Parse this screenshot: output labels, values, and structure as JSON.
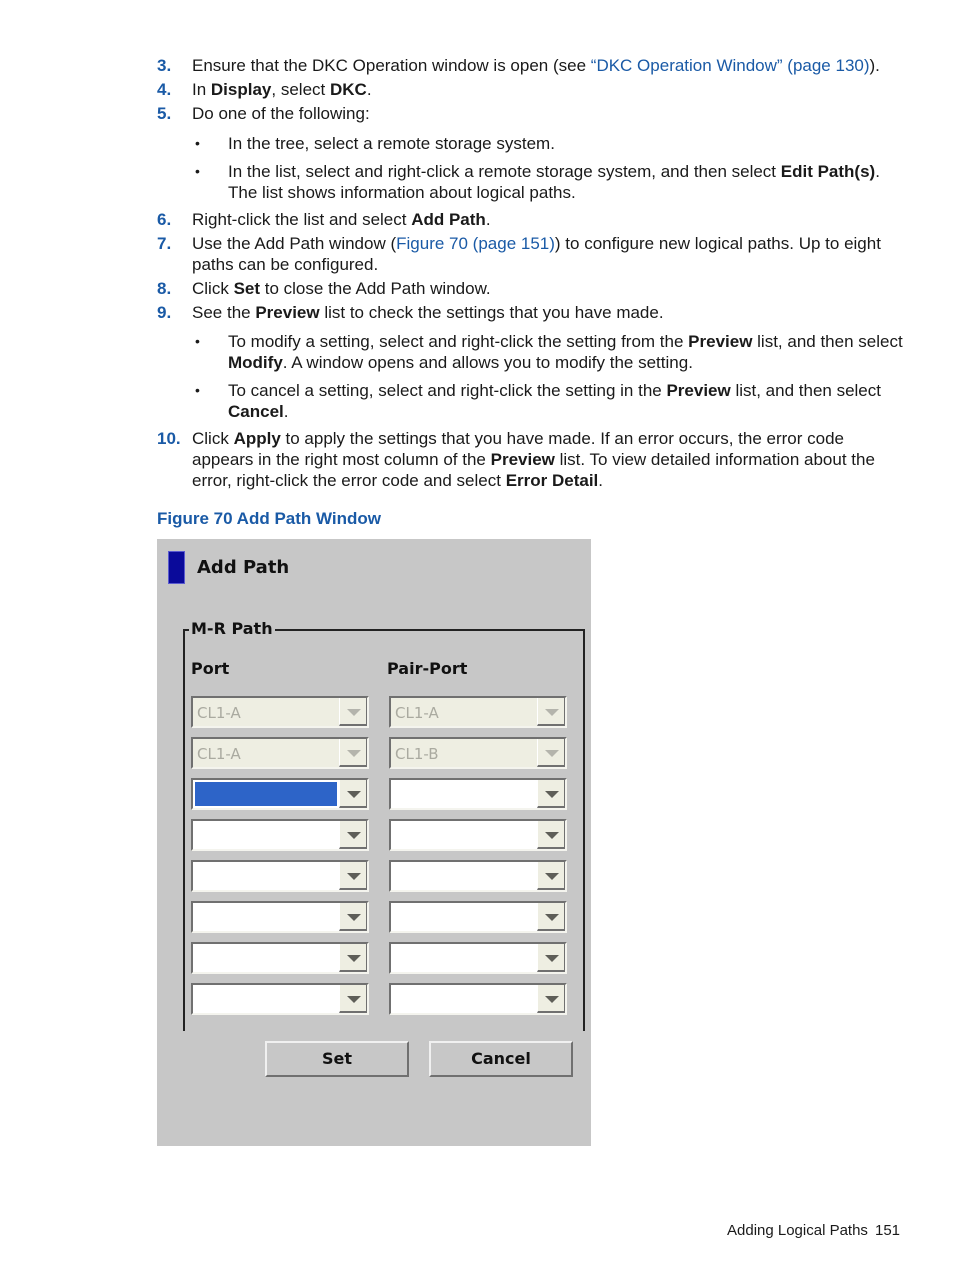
{
  "steps": [
    {
      "num": "3.",
      "parts": {
        "a": "Ensure that the DKC Operation window is open (see ",
        "link": "“DKC Operation Window” (page 130)",
        "b": ")."
      }
    },
    {
      "num": "4.",
      "parts": {
        "a": "In ",
        "b1": "Display",
        "c": ", select ",
        "b2": "DKC",
        "d": "."
      }
    },
    {
      "num": "5.",
      "text": "Do one of the following:"
    },
    {
      "num": "6.",
      "parts": {
        "a": "Right-click the list and select ",
        "b1": "Add Path",
        "c": "."
      }
    },
    {
      "num": "7.",
      "parts": {
        "a": "Use the Add Path window (",
        "link": "Figure 70 (page 151)",
        "b": ") to configure new logical paths. Up to eight paths can be configured."
      }
    },
    {
      "num": "8.",
      "parts": {
        "a": "Click ",
        "b1": "Set",
        "c": " to close the Add Path window."
      }
    },
    {
      "num": "9.",
      "parts": {
        "a": "See the ",
        "b1": "Preview",
        "c": " list to check the settings that you have made."
      }
    },
    {
      "num": "10.",
      "parts": {
        "a": "Click ",
        "b1": "Apply",
        "c": " to apply the settings that you have made. If an error occurs, the error code appears in the right most column of the ",
        "b2": "Preview",
        "d": " list. To view detailed information about the error, right-click the error code and select ",
        "b3": "Error Detail",
        "e": "."
      }
    }
  ],
  "bullets5": [
    {
      "a": "In the tree, select a remote storage system."
    },
    {
      "a": "In the list, select and right-click a remote storage system, and then select ",
      "b1": "Edit Path(s)",
      "c": ". The list shows information about logical paths."
    }
  ],
  "bullets9": [
    {
      "a": "To modify a setting, select and right-click the setting from the ",
      "b1": "Preview",
      "c": " list, and then select ",
      "b2": "Modify",
      "d": ". A window opens and allows you to modify the setting."
    },
    {
      "a": "To cancel a setting, select and right-click the setting in the ",
      "b1": "Preview",
      "c": " list, and then select ",
      "b2": "Cancel",
      "d": "."
    }
  ],
  "bullet_glyph": "•",
  "figure_caption": "Figure 70 Add Path Window",
  "dialog": {
    "title": "Add Path",
    "group_label": "M-R Path",
    "port_label": "Port",
    "pair_port_label": "Pair-Port",
    "rows": [
      {
        "port": "CL1-A",
        "pair_port": "CL1-A",
        "disabled": true
      },
      {
        "port": "CL1-A",
        "pair_port": "CL1-B",
        "disabled": true
      },
      {
        "port": "",
        "pair_port": "",
        "disabled": false,
        "port_selected": true
      },
      {
        "port": "",
        "pair_port": "",
        "disabled": false
      },
      {
        "port": "",
        "pair_port": "",
        "disabled": false
      },
      {
        "port": "",
        "pair_port": "",
        "disabled": false
      },
      {
        "port": "",
        "pair_port": "",
        "disabled": false
      },
      {
        "port": "",
        "pair_port": "",
        "disabled": false
      }
    ],
    "set_label": "Set",
    "cancel_label": "Cancel",
    "title_accent_color": "#0a0a9a",
    "selection_color": "#2d64c8"
  },
  "footer": {
    "section": "Adding Logical Paths",
    "page": "151"
  }
}
